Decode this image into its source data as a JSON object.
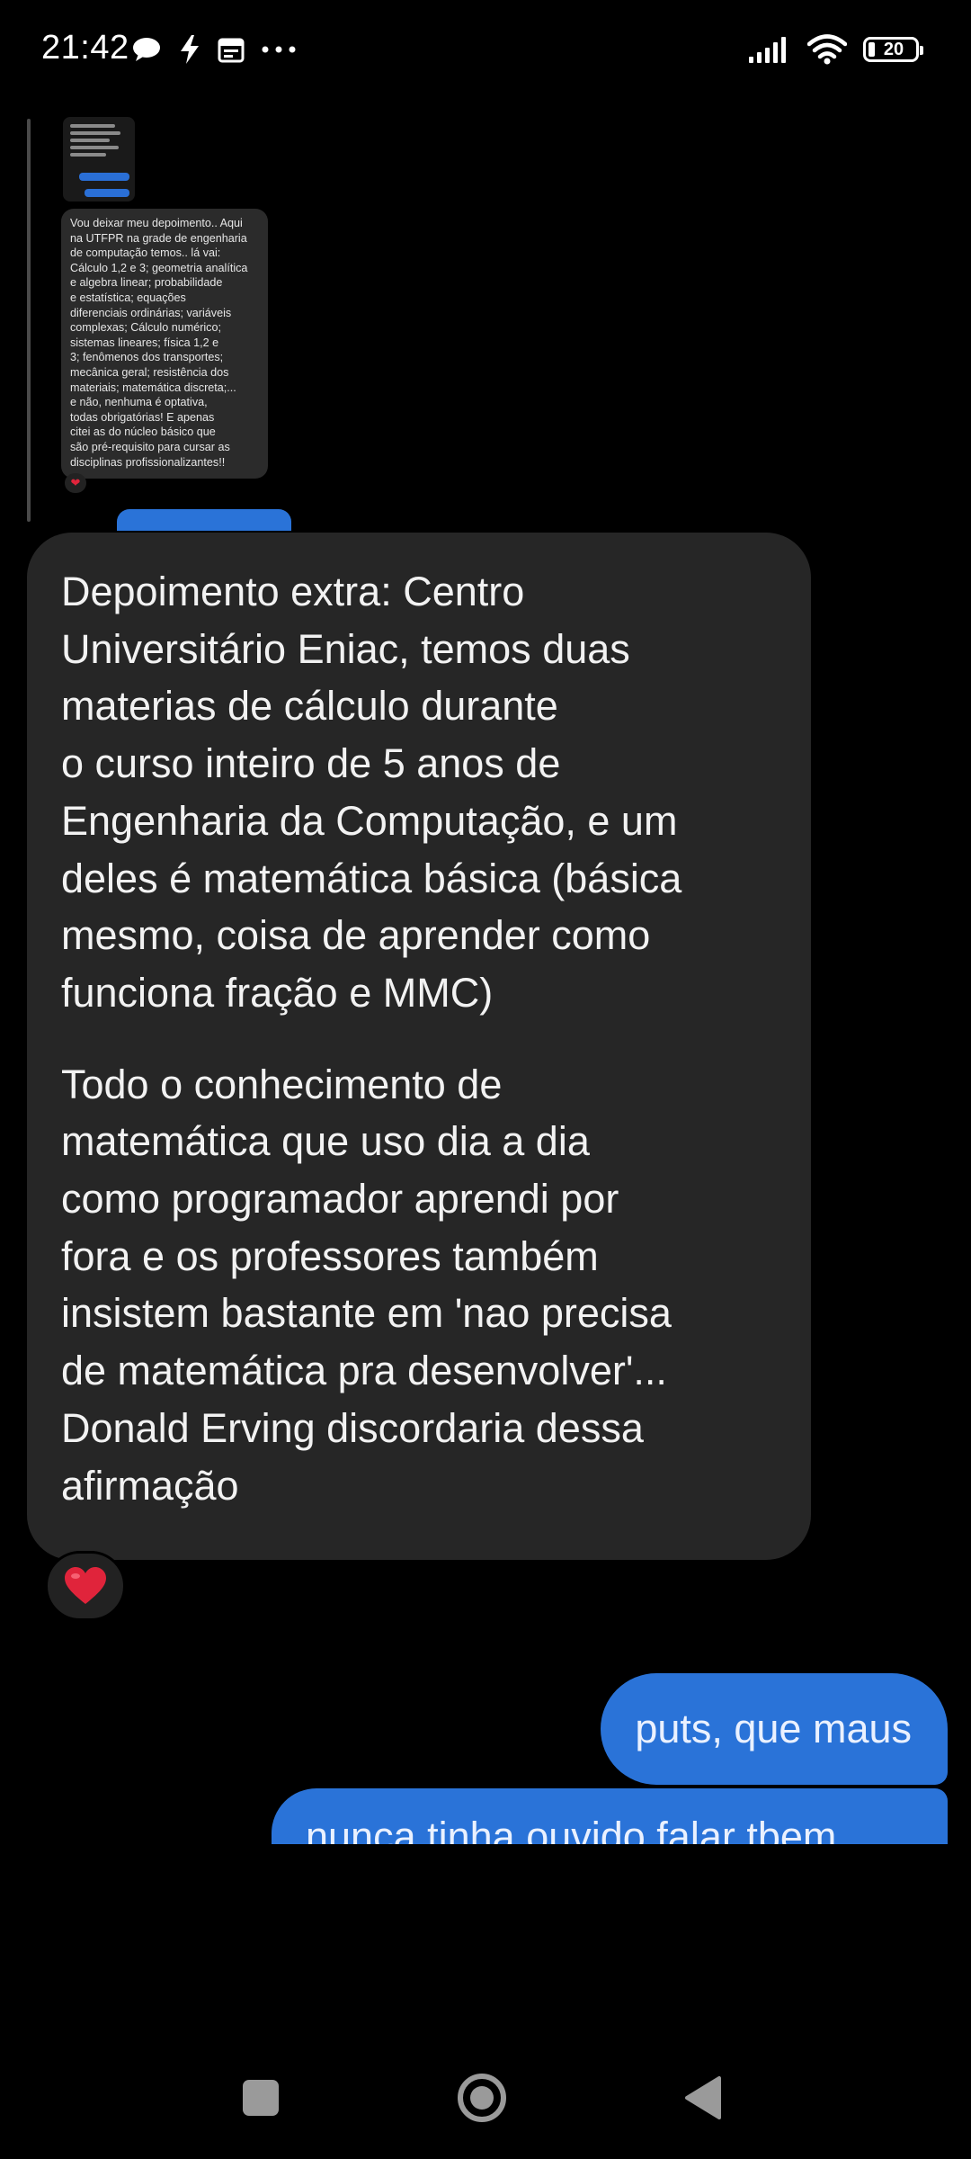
{
  "status_bar": {
    "time": "21:42",
    "left_icons": [
      "chat-bubble-icon",
      "flash-icon",
      "calendar-icon",
      "more-dots-icon"
    ],
    "right_icons": [
      "signal-icon",
      "wifi-icon",
      "battery-icon"
    ],
    "battery_level": "20"
  },
  "quoted_message": {
    "text": "Vou deixar meu depoimento.. Aqui\nna UTFPR na grade de engenharia\nde computação temos.. lá vai:\nCálculo 1,2 e 3; geometria analítica\ne algebra linear; probabilidade\ne estatística; equações\ndiferenciais ordinárias; variáveis\ncomplexas; Cálculo numérico;\nsistemas lineares; física 1,2 e\n3; fenômenos dos transportes;\nmecânica geral; resistência dos\nmateriais; matemática discreta;...\ne não, nenhuma é optativa,\ntodas obrigatórias! E apenas\ncitei as do núcleo básico que\nsão pré-requisito para cursar as\ndisciplinas profissionalizantes!!",
    "reaction": "❤"
  },
  "received_message": {
    "paragraph_1": "Depoimento extra: Centro\nUniversitário Eniac, temos duas\nmaterias de cálculo durante\no curso inteiro de 5 anos de\nEngenharia da Computação, e um\ndeles é matemática básica (básica\nmesmo, coisa de aprender como\nfunciona fração e MMC)",
    "paragraph_2": "Todo o conhecimento de\nmatemática que uso dia a dia\ncomo programador aprendi por\nfora e os professores também\ninsistem bastante em 'nao precisa\nde matemática pra desenvolver'...\nDonald Erving discordaria dessa\nafirmação",
    "reaction": "heart"
  },
  "sent_messages": [
    {
      "text": "puts, que maus"
    },
    {
      "text": "nunca tinha ouvido falar tbem"
    }
  ],
  "colors": {
    "background": "#000000",
    "received_bubble": "#262626",
    "sent_bubble": "#2a73d8",
    "heart": "#e0243b"
  },
  "nav_bar": {
    "buttons": [
      "recents-button",
      "home-button",
      "back-button"
    ]
  }
}
